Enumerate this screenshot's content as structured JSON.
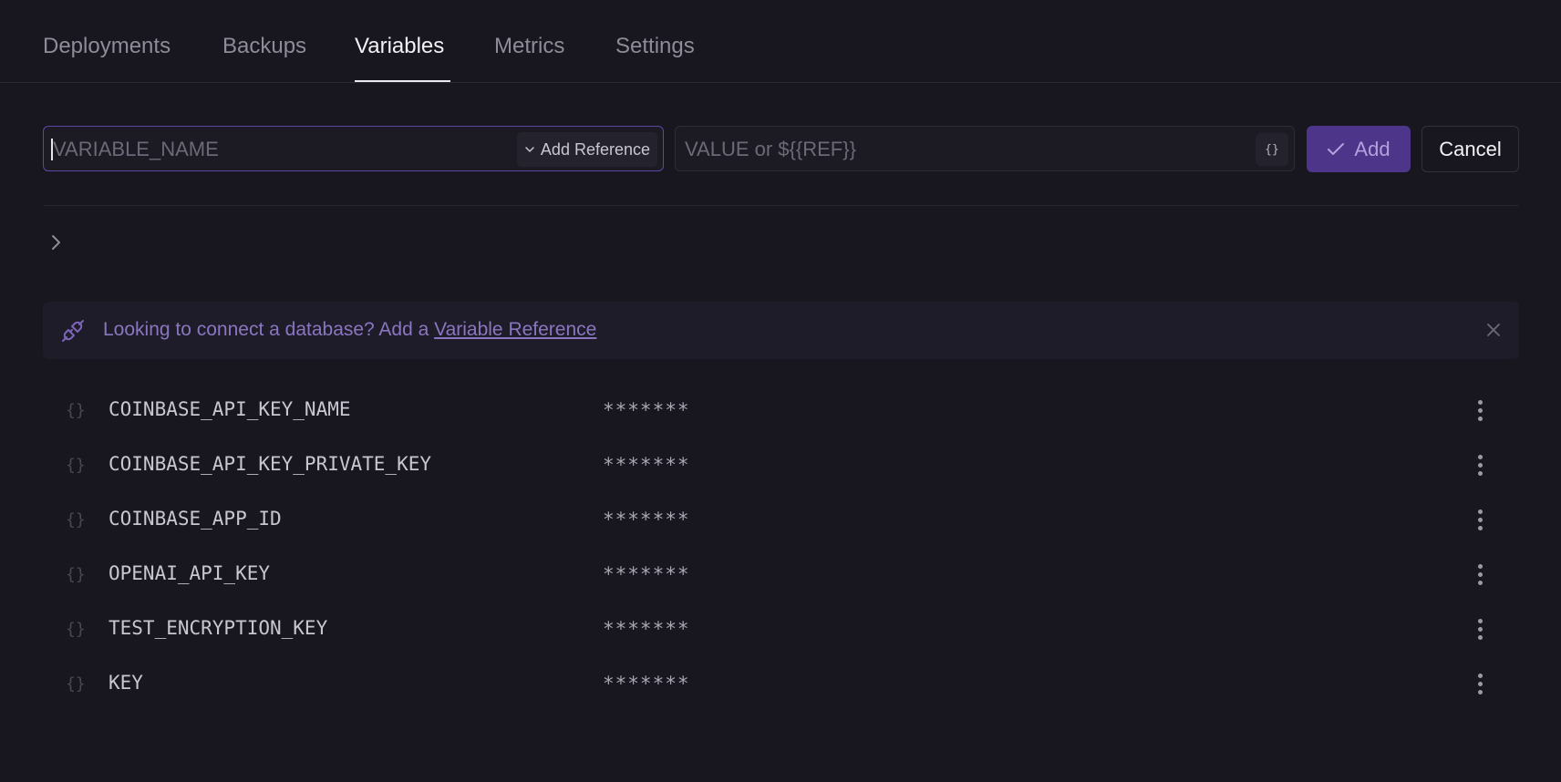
{
  "tabs": [
    {
      "label": "Deployments",
      "active": false
    },
    {
      "label": "Backups",
      "active": false
    },
    {
      "label": "Variables",
      "active": true
    },
    {
      "label": "Metrics",
      "active": false
    },
    {
      "label": "Settings",
      "active": false
    }
  ],
  "form": {
    "name_placeholder": "VARIABLE_NAME",
    "name_value": "",
    "add_reference_label": "Add Reference",
    "value_placeholder": "VALUE or ${{REF}}",
    "value_value": "",
    "reference_button_label": "{}",
    "add_label": "Add",
    "cancel_label": "Cancel"
  },
  "banner": {
    "text": "Looking to connect a database? Add a ",
    "link_label": "Variable Reference"
  },
  "variables": [
    {
      "name": "COINBASE_API_KEY_NAME",
      "value": "*******"
    },
    {
      "name": "COINBASE_API_KEY_PRIVATE_KEY",
      "value": "*******"
    },
    {
      "name": "COINBASE_APP_ID",
      "value": "*******"
    },
    {
      "name": "OPENAI_API_KEY",
      "value": "*******"
    },
    {
      "name": "TEST_ENCRYPTION_KEY",
      "value": "*******"
    },
    {
      "name": "KEY",
      "value": "*******"
    }
  ],
  "variable_icon_glyph": "{}",
  "colors": {
    "background": "#18161f",
    "accent": "#4d3589",
    "accent_text": "#8a76c0"
  }
}
